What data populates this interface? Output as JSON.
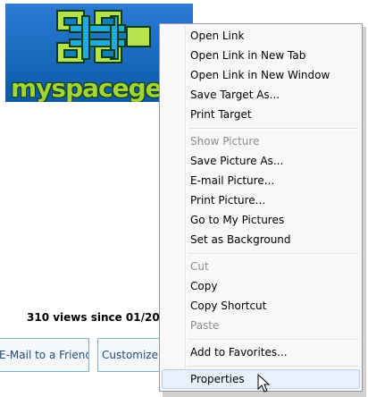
{
  "banner": {
    "logo_text": "myspacegen"
  },
  "page": {
    "views_text": "310 views since 01/20",
    "email_button": "E-Mail to a Friend",
    "customize_button": "Customize"
  },
  "context_menu": {
    "items": [
      {
        "label": "Open Link",
        "disabled": false
      },
      {
        "label": "Open Link in New Tab",
        "disabled": false
      },
      {
        "label": "Open Link in New Window",
        "disabled": false
      },
      {
        "label": "Save Target As...",
        "disabled": false
      },
      {
        "label": "Print Target",
        "disabled": false
      },
      {
        "label": "Show Picture",
        "disabled": true
      },
      {
        "label": "Save Picture As...",
        "disabled": false
      },
      {
        "label": "E-mail Picture...",
        "disabled": false
      },
      {
        "label": "Print Picture...",
        "disabled": false
      },
      {
        "label": "Go to My Pictures",
        "disabled": false
      },
      {
        "label": "Set as Background",
        "disabled": false
      },
      {
        "label": "Cut",
        "disabled": true
      },
      {
        "label": "Copy",
        "disabled": false
      },
      {
        "label": "Copy Shortcut",
        "disabled": false
      },
      {
        "label": "Paste",
        "disabled": true
      },
      {
        "label": "Add to Favorites...",
        "disabled": false
      },
      {
        "label": "Properties",
        "disabled": false,
        "highlighted": true
      }
    ]
  },
  "colors": {
    "banner_bg": "#0a7fbf",
    "logo_green": "#9fd43a",
    "menu_bg": "#f8f8f8",
    "highlight_bg": "#e8f1fb"
  }
}
